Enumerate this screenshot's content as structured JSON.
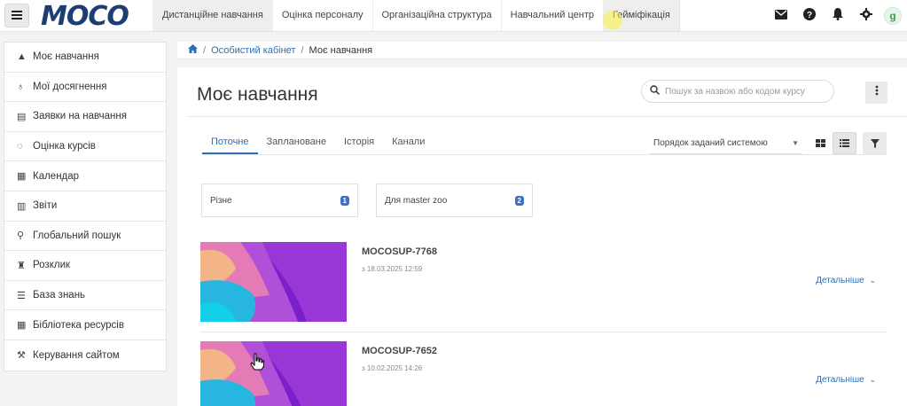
{
  "app": {
    "logo_text": "MOCO",
    "menu_icon": "hamburger-icon"
  },
  "topnav": {
    "items": [
      {
        "label": "Дистанційне навчання"
      },
      {
        "label": "Оцінка персоналу"
      },
      {
        "label": "Організаційна структура"
      },
      {
        "label": "Навчальний центр"
      },
      {
        "label": "Гейміфікація"
      }
    ],
    "icons": [
      "envelope-icon",
      "question-icon",
      "bell-icon",
      "gear-icon",
      "user-avatar-icon"
    ],
    "avatar_letter": "g"
  },
  "sidebar": {
    "items": [
      {
        "label": "Моє навчання",
        "icon": "graduation-cap-icon",
        "glyph": "🎓"
      },
      {
        "label": "Мої досягнення",
        "icon": "medal-icon",
        "glyph": "🎖"
      },
      {
        "label": "Заявки на навчання",
        "icon": "clipboard-icon",
        "glyph": "📋"
      },
      {
        "label": "Оцінка курсів",
        "icon": "comment-icon",
        "glyph": "💬"
      },
      {
        "label": "Календар",
        "icon": "calendar-icon",
        "glyph": "📅"
      },
      {
        "label": "Звіти",
        "icon": "bar-chart-icon",
        "glyph": "📊"
      },
      {
        "label": "Глобальний пошук",
        "icon": "search-icon",
        "glyph": "🔍"
      },
      {
        "label": "Розклик",
        "icon": "trophy-icon",
        "glyph": "🏆"
      },
      {
        "label": "База знань",
        "icon": "book-icon",
        "glyph": "📖"
      },
      {
        "label": "Бібліотека ресурсів",
        "icon": "table-icon",
        "glyph": "▦"
      },
      {
        "label": "Керування сайтом",
        "icon": "wrench-icon",
        "glyph": "🔧"
      }
    ]
  },
  "breadcrumb": {
    "home_icon": "home-icon",
    "items": [
      {
        "label": "Особистий кабінет"
      },
      {
        "label": "Моє навчання"
      }
    ]
  },
  "main": {
    "title": "Моє навчання",
    "search_placeholder": "Пошук за назвою або кодом курсу",
    "tabs": [
      {
        "label": "Поточне"
      },
      {
        "label": "Заплановане"
      },
      {
        "label": "Історія"
      },
      {
        "label": "Канали"
      }
    ],
    "sort_value": "Порядок заданий системою",
    "categories": [
      {
        "label": "Різне",
        "count": "1"
      },
      {
        "label": "Для master zoo",
        "count": "2"
      }
    ],
    "courses": [
      {
        "title": "MOCOSUP-7768",
        "date": "з 18.03.2025 12:59",
        "more": "Детальніше"
      },
      {
        "title": "MOCOSUP-7652",
        "date": "з 10.02.2025 14:26",
        "more": "Детальніше"
      }
    ]
  },
  "colors": {
    "accent": "#2f6db5",
    "logo": "#1d3e74",
    "badge": "#3a73c6"
  }
}
